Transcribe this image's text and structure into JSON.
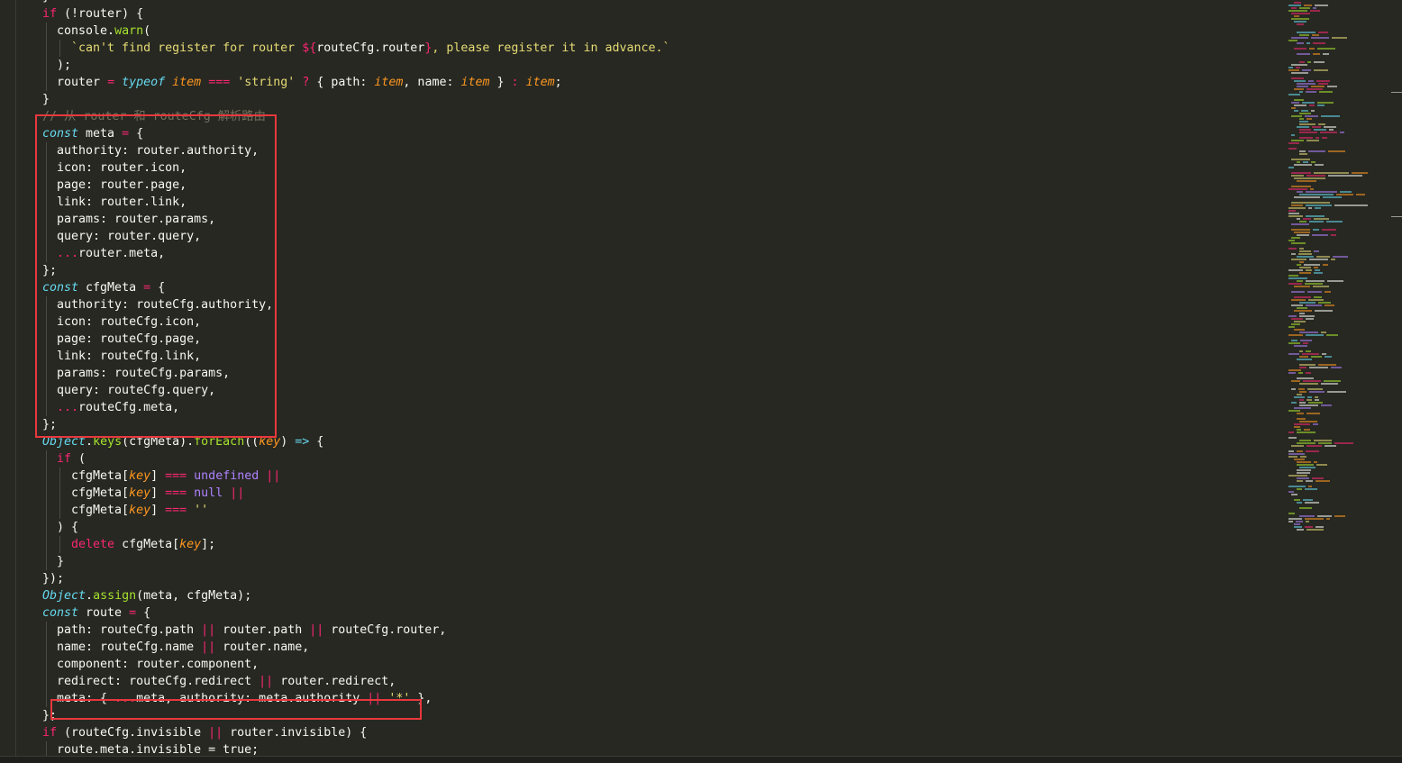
{
  "editor": {
    "theme_colors": {
      "background": "#272822",
      "keyword": "#f92672",
      "string": "#e6db74",
      "function": "#a6e22e",
      "storage": "#66d9ef",
      "parameter": "#fd971f",
      "constant": "#ae81ff",
      "comment": "#75715e",
      "highlight_box": "#e8383d"
    },
    "lines": [
      [
        [
          "plain",
          "}"
        ]
      ],
      [
        [
          "keyword",
          "if"
        ],
        [
          "plain",
          " (!router) {"
        ]
      ],
      [
        [
          "plain",
          "  console."
        ],
        [
          "func",
          "warn"
        ],
        [
          "plain",
          "("
        ]
      ],
      [
        [
          "string",
          "    `can't find register for router "
        ],
        [
          "interp",
          "${"
        ],
        [
          "plain",
          "routeCfg.router"
        ],
        [
          "interp",
          "}"
        ],
        [
          "string",
          ", please register it in advance.`"
        ]
      ],
      [
        [
          "plain",
          "  );"
        ]
      ],
      [
        [
          "plain",
          "  router "
        ],
        [
          "op",
          "="
        ],
        [
          "plain",
          " "
        ],
        [
          "storage",
          "typeof"
        ],
        [
          "plain",
          " "
        ],
        [
          "param",
          "item"
        ],
        [
          "plain",
          " "
        ],
        [
          "op",
          "==="
        ],
        [
          "plain",
          " "
        ],
        [
          "string",
          "'string'"
        ],
        [
          "plain",
          " "
        ],
        [
          "op",
          "?"
        ],
        [
          "plain",
          " { path: "
        ],
        [
          "param",
          "item"
        ],
        [
          "plain",
          ", name: "
        ],
        [
          "param",
          "item"
        ],
        [
          "plain",
          " } "
        ],
        [
          "op",
          ":"
        ],
        [
          "plain",
          " "
        ],
        [
          "param",
          "item"
        ],
        [
          "plain",
          ";"
        ]
      ],
      [
        [
          "plain",
          "}"
        ]
      ],
      [
        [
          "comment",
          "// 从 router 和 routeCfg 解析路由"
        ]
      ],
      [
        [
          "storage",
          "const"
        ],
        [
          "plain",
          " meta "
        ],
        [
          "op",
          "="
        ],
        [
          "plain",
          " {"
        ]
      ],
      [
        [
          "plain",
          "  authority: router.authority,"
        ]
      ],
      [
        [
          "plain",
          "  icon: router.icon,"
        ]
      ],
      [
        [
          "plain",
          "  page: router.page,"
        ]
      ],
      [
        [
          "plain",
          "  link: router.link,"
        ]
      ],
      [
        [
          "plain",
          "  params: router.params,"
        ]
      ],
      [
        [
          "plain",
          "  query: router.query,"
        ]
      ],
      [
        [
          "plain",
          "  "
        ],
        [
          "op",
          "..."
        ],
        [
          "plain",
          "router.meta,"
        ]
      ],
      [
        [
          "plain",
          "};"
        ]
      ],
      [
        [
          "storage",
          "const"
        ],
        [
          "plain",
          " cfgMeta "
        ],
        [
          "op",
          "="
        ],
        [
          "plain",
          " {"
        ]
      ],
      [
        [
          "plain",
          "  authority: routeCfg.authority,"
        ]
      ],
      [
        [
          "plain",
          "  icon: routeCfg.icon,"
        ]
      ],
      [
        [
          "plain",
          "  page: routeCfg.page,"
        ]
      ],
      [
        [
          "plain",
          "  link: routeCfg.link,"
        ]
      ],
      [
        [
          "plain",
          "  params: routeCfg.params,"
        ]
      ],
      [
        [
          "plain",
          "  query: routeCfg.query,"
        ]
      ],
      [
        [
          "plain",
          "  "
        ],
        [
          "op",
          "..."
        ],
        [
          "plain",
          "routeCfg.meta,"
        ]
      ],
      [
        [
          "plain",
          "};"
        ]
      ],
      [
        [
          "storage",
          "Object"
        ],
        [
          "plain",
          "."
        ],
        [
          "func",
          "keys"
        ],
        [
          "plain",
          "(cfgMeta)."
        ],
        [
          "func",
          "forEach"
        ],
        [
          "plain",
          "(("
        ],
        [
          "param",
          "key"
        ],
        [
          "plain",
          ") "
        ],
        [
          "storage",
          "=>"
        ],
        [
          "plain",
          " {"
        ]
      ],
      [
        [
          "plain",
          "  "
        ],
        [
          "keyword",
          "if"
        ],
        [
          "plain",
          " ("
        ]
      ],
      [
        [
          "plain",
          "    cfgMeta["
        ],
        [
          "param",
          "key"
        ],
        [
          "plain",
          "] "
        ],
        [
          "op",
          "==="
        ],
        [
          "plain",
          " "
        ],
        [
          "const",
          "undefined"
        ],
        [
          "plain",
          " "
        ],
        [
          "op",
          "||"
        ]
      ],
      [
        [
          "plain",
          "    cfgMeta["
        ],
        [
          "param",
          "key"
        ],
        [
          "plain",
          "] "
        ],
        [
          "op",
          "==="
        ],
        [
          "plain",
          " "
        ],
        [
          "const",
          "null"
        ],
        [
          "plain",
          " "
        ],
        [
          "op",
          "||"
        ]
      ],
      [
        [
          "plain",
          "    cfgMeta["
        ],
        [
          "param",
          "key"
        ],
        [
          "plain",
          "] "
        ],
        [
          "op",
          "==="
        ],
        [
          "plain",
          " "
        ],
        [
          "string",
          "''"
        ]
      ],
      [
        [
          "plain",
          "  ) {"
        ]
      ],
      [
        [
          "plain",
          "    "
        ],
        [
          "keyword",
          "delete"
        ],
        [
          "plain",
          " cfgMeta["
        ],
        [
          "param",
          "key"
        ],
        [
          "plain",
          "];"
        ]
      ],
      [
        [
          "plain",
          "  }"
        ]
      ],
      [
        [
          "plain",
          "});"
        ]
      ],
      [
        [
          "storage",
          "Object"
        ],
        [
          "plain",
          "."
        ],
        [
          "func",
          "assign"
        ],
        [
          "plain",
          "(meta, cfgMeta);"
        ]
      ],
      [
        [
          "storage",
          "const"
        ],
        [
          "plain",
          " route "
        ],
        [
          "op",
          "="
        ],
        [
          "plain",
          " {"
        ]
      ],
      [
        [
          "plain",
          "  path: routeCfg.path "
        ],
        [
          "op",
          "||"
        ],
        [
          "plain",
          " router.path "
        ],
        [
          "op",
          "||"
        ],
        [
          "plain",
          " routeCfg.router,"
        ]
      ],
      [
        [
          "plain",
          "  name: routeCfg.name "
        ],
        [
          "op",
          "||"
        ],
        [
          "plain",
          " router.name,"
        ]
      ],
      [
        [
          "plain",
          "  component: router.component,"
        ]
      ],
      [
        [
          "plain",
          "  redirect: routeCfg.redirect "
        ],
        [
          "op",
          "||"
        ],
        [
          "plain",
          " router.redirect,"
        ]
      ],
      [
        [
          "plain",
          "  meta: { "
        ],
        [
          "op",
          "..."
        ],
        [
          "plain",
          "meta, authority: meta.authority "
        ],
        [
          "op",
          "||"
        ],
        [
          "plain",
          " "
        ],
        [
          "string",
          "'*'"
        ],
        [
          "plain",
          " },"
        ]
      ],
      [
        [
          "plain",
          "};"
        ]
      ],
      [
        [
          "keyword",
          "if"
        ],
        [
          "plain",
          " (routeCfg.invisible "
        ],
        [
          "op",
          "||"
        ],
        [
          "plain",
          " router.invisible) {"
        ]
      ],
      [
        [
          "plain",
          "  route.meta.invisible = true;"
        ]
      ]
    ]
  }
}
